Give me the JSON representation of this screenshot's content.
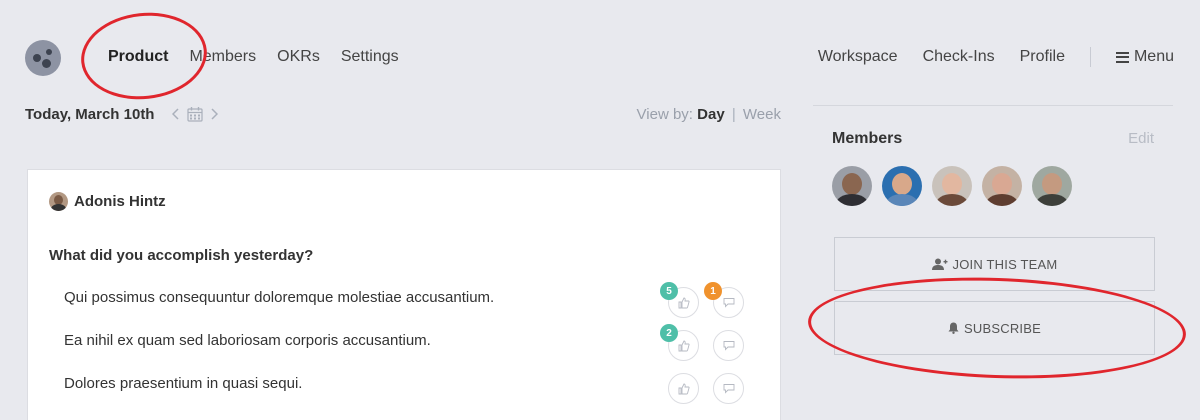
{
  "nav": {
    "left": [
      "Product",
      "Members",
      "OKRs",
      "Settings"
    ],
    "right": [
      "Workspace",
      "Check-Ins",
      "Profile"
    ],
    "menu_label": "Menu"
  },
  "date_bar": {
    "title": "Today, March 10th",
    "view_by_label": "View by:",
    "day": "Day",
    "separator": "|",
    "week": "Week"
  },
  "checkin": {
    "author": "Adonis Hintz",
    "question": "What did you accomplish yesterday?",
    "answers": [
      {
        "text": "Qui possimus consequuntur doloremque molestiae accusantium.",
        "likes": "5",
        "comments": "1"
      },
      {
        "text": "Ea nihil ex quam sed laboriosam corporis accusantium.",
        "likes": "2",
        "comments": ""
      },
      {
        "text": "Dolores praesentium in quasi sequi.",
        "likes": "",
        "comments": ""
      }
    ]
  },
  "sidebar": {
    "members_title": "Members",
    "edit": "Edit",
    "join_button": "JOIN THIS TEAM",
    "subscribe_button": "SUBSCRIBE"
  },
  "colors": {
    "background": "#e8e9ee",
    "badge_teal": "#4fbfa8",
    "badge_orange": "#f0922d",
    "annotation_red": "#e0262d"
  },
  "icons": [
    "logo-icon",
    "hamburger-icon",
    "chevron-left-icon",
    "calendar-icon",
    "chevron-right-icon",
    "thumbs-up-icon",
    "comment-icon",
    "user-plus-icon",
    "bell-icon"
  ]
}
